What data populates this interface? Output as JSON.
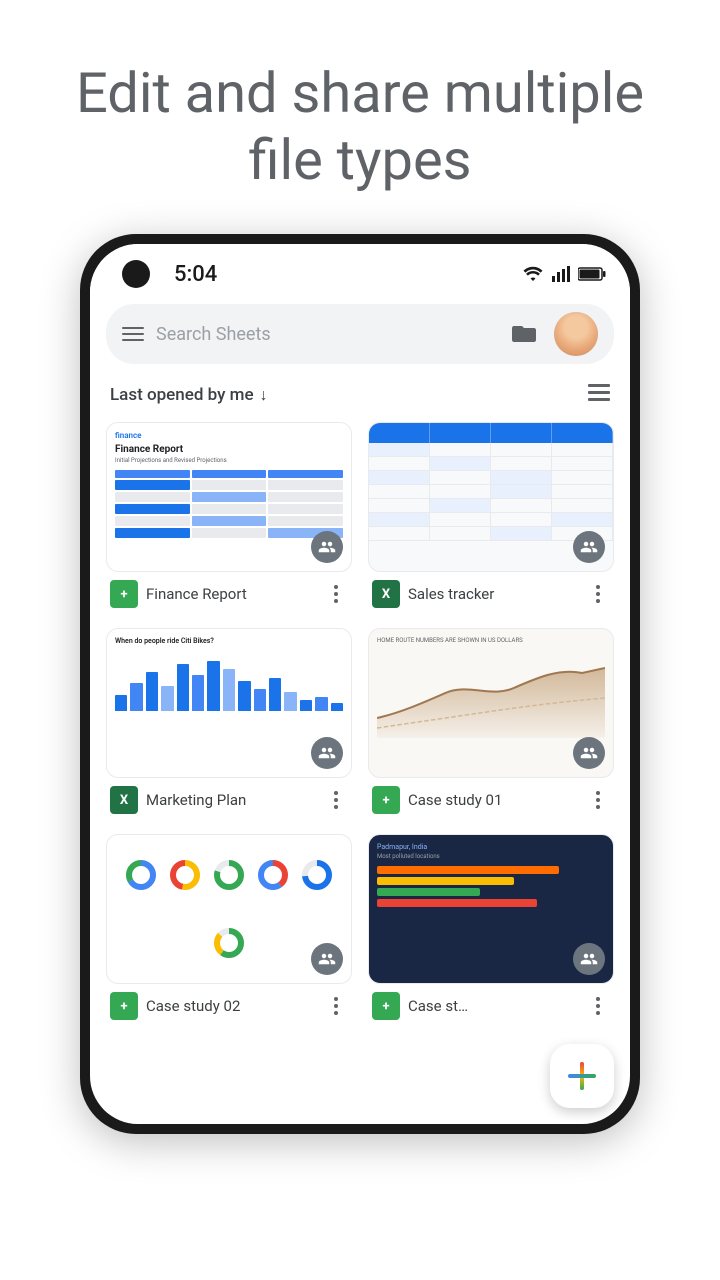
{
  "hero": {
    "title": "Edit and share multiple file types"
  },
  "status_bar": {
    "time": "5:04"
  },
  "search": {
    "placeholder": "Search Sheets"
  },
  "sort": {
    "label": "Last opened by me",
    "arrow": "↓"
  },
  "files": [
    {
      "id": "finance-report",
      "name": "Finance Report",
      "type": "sheets",
      "type_label": "+"
    },
    {
      "id": "sales-tracker",
      "name": "Sales tracker",
      "type": "excel",
      "type_label": "X"
    },
    {
      "id": "marketing-plan",
      "name": "Marketing Plan",
      "type": "excel",
      "type_label": "X"
    },
    {
      "id": "case-study-01",
      "name": "Case study 01",
      "type": "sheets",
      "type_label": "+"
    },
    {
      "id": "case-study-02",
      "name": "Case study 02",
      "type": "sheets",
      "type_label": "+"
    },
    {
      "id": "case-study-last",
      "name": "Case st…",
      "type": "sheets",
      "type_label": "+"
    }
  ],
  "fab": {
    "label": "New file"
  }
}
